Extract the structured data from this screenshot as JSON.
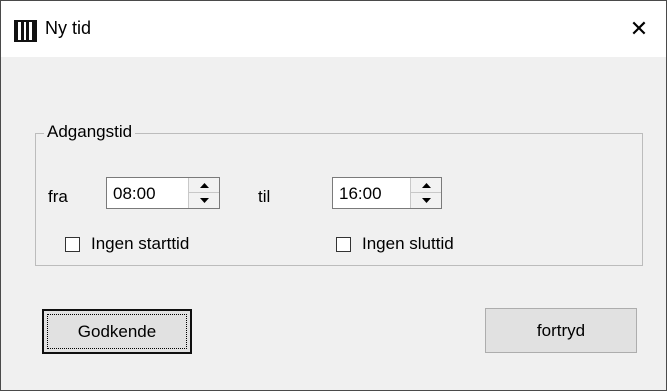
{
  "window": {
    "title": "Ny tid",
    "app_icon": "app-icon",
    "close_icon": "close-icon",
    "close_glyph": "✕"
  },
  "group": {
    "label": "Adgangstid",
    "from_label": "fra",
    "from_value": "08:00",
    "to_label": "til",
    "to_value": "16:00",
    "no_start_label": "Ingen starttid",
    "no_start_checked": false,
    "no_end_label": "Ingen sluttid",
    "no_end_checked": false
  },
  "buttons": {
    "ok_label": "Godkende",
    "cancel_label": "fortryd"
  },
  "colors": {
    "window_bg": "#f0f0f0",
    "titlebar_bg": "#ffffff",
    "button_bg": "#e1e1e1"
  }
}
